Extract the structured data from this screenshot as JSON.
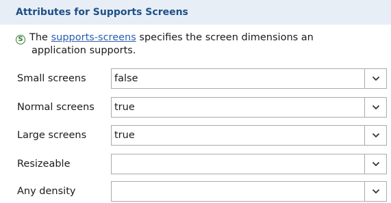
{
  "header": {
    "title": "Attributes for Supports Screens"
  },
  "description": {
    "icon": "s-circle-icon",
    "prefix": "The ",
    "link": "supports-screens",
    "suffix": " specifies the screen dimensions an",
    "line2": "application supports."
  },
  "fields": [
    {
      "label": "Small screens",
      "value": "false"
    },
    {
      "label": "Normal screens",
      "value": "true"
    },
    {
      "label": "Large screens",
      "value": "true"
    },
    {
      "label": "Resizeable",
      "value": ""
    },
    {
      "label": "Any density",
      "value": ""
    }
  ],
  "colors": {
    "header_bg": "#e8eef6",
    "header_text": "#1d4f87",
    "link": "#2a5db0",
    "icon": "#2e7d32"
  }
}
